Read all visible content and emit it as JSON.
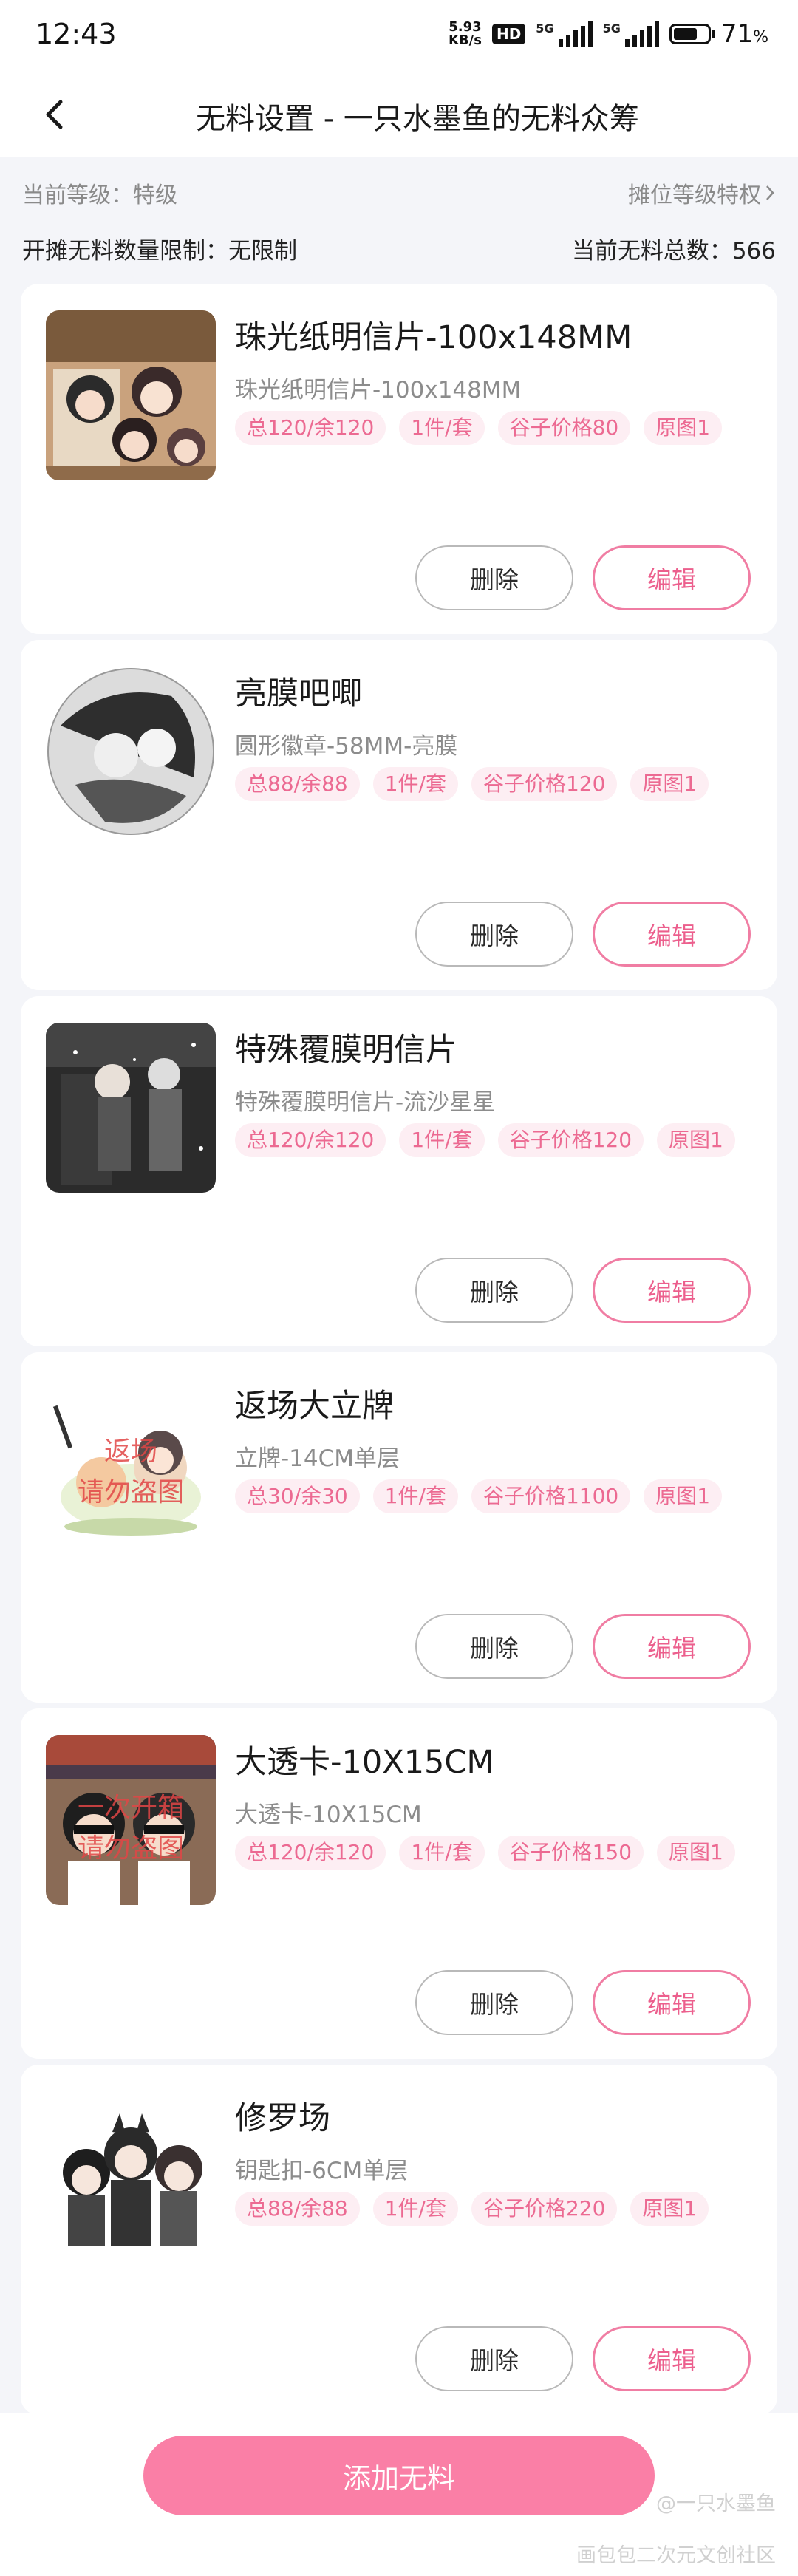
{
  "status": {
    "time": "12:43",
    "net_speed_value": "5.93",
    "net_speed_unit": "KB/s",
    "hd": "HD",
    "sim1": "5G",
    "sim2": "5G",
    "battery_percent_value": "71",
    "battery_percent_sign": "%",
    "battery_level": 0.71
  },
  "header": {
    "title": "无料设置 - 一只水墨鱼的无料众筹",
    "back_icon": "chevron-left-icon"
  },
  "info": {
    "current_level": "当前等级：特级",
    "stall_privileges": "摊位等级特权",
    "stall_limit": "开摊无料数量限制：无限制",
    "total_count": "当前无料总数：566"
  },
  "colors": {
    "accent": "#fa7fa6",
    "tag_text": "#ec6a92",
    "tag_bg": "#fdeef3",
    "background": "#f4f5f9"
  },
  "items": [
    {
      "title": "珠光纸明信片-100x148MM",
      "subtitle": "珠光纸明信片-100x148MM",
      "tags": [
        "总120/余120",
        "1件/套",
        "谷子价格80",
        "原图1"
      ],
      "thumb_icon": "chibi-illustration-thumbnail",
      "overlay_lines": []
    },
    {
      "title": "亮膜吧唧",
      "subtitle": "圆形徽章-58MM-亮膜",
      "tags": [
        "总88/余88",
        "1件/套",
        "谷子价格120",
        "原图1"
      ],
      "thumb_icon": "round-badge-thumbnail",
      "overlay_lines": []
    },
    {
      "title": "特殊覆膜明信片",
      "subtitle": "特殊覆膜明信片-流沙星星",
      "tags": [
        "总120/余120",
        "1件/套",
        "谷子价格120",
        "原图1"
      ],
      "thumb_icon": "dark-illustration-thumbnail",
      "overlay_lines": []
    },
    {
      "title": "返场大立牌",
      "subtitle": "立牌-14CM单层",
      "tags": [
        "总30/余30",
        "1件/套",
        "谷子价格1100",
        "原图1"
      ],
      "thumb_icon": "standee-thumbnail",
      "overlay_lines": [
        "返场",
        "请勿盗图"
      ]
    },
    {
      "title": "大透卡-10X15CM",
      "subtitle": "大透卡-10X15CM",
      "tags": [
        "总120/余120",
        "1件/套",
        "谷子价格150",
        "原图1"
      ],
      "thumb_icon": "clear-card-thumbnail",
      "overlay_lines": [
        "一次开箱",
        "请勿盗图"
      ]
    },
    {
      "title": "修罗场",
      "subtitle": "钥匙扣-6CM单层",
      "tags": [
        "总88/余88",
        "1件/套",
        "谷子价格220",
        "原图1"
      ],
      "thumb_icon": "keychain-thumbnail",
      "overlay_lines": []
    }
  ],
  "buttons": {
    "delete": "删除",
    "edit": "编辑",
    "add": "添加无料"
  },
  "watermark": {
    "line1": "@一只水墨鱼",
    "line2": "画包包二次元文创社区"
  }
}
